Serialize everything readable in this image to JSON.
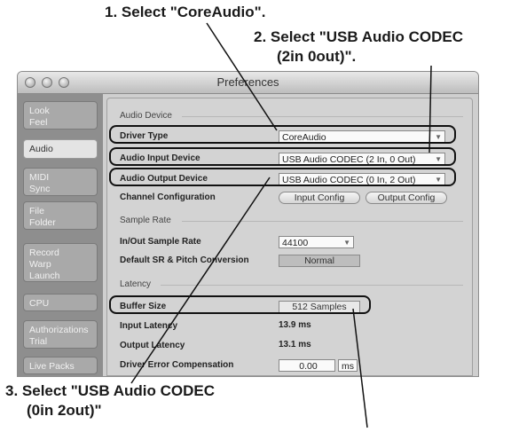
{
  "callouts": {
    "c1": "1. Select \"CoreAudio\".",
    "c2_line1": "2. Select \"USB Audio CODEC",
    "c2_line2": "(2in 0out)\".",
    "c3_line1": "3. Select \"USB Audio CODEC",
    "c3_line2": "(0in 2out)\""
  },
  "window": {
    "title": "Preferences"
  },
  "sidebar": {
    "tabs": [
      {
        "label": "Look\nFeel"
      },
      {
        "label": "Audio"
      },
      {
        "label": "MIDI\nSync"
      },
      {
        "label": "File\nFolder"
      },
      {
        "label": "Record\nWarp\nLaunch"
      },
      {
        "label": "CPU"
      },
      {
        "label": "Authorizations\nTrial"
      },
      {
        "label": "Live Packs"
      }
    ]
  },
  "audio_device": {
    "section": "Audio Device",
    "driver_type_label": "Driver Type",
    "driver_type_value": "CoreAudio",
    "input_device_label": "Audio Input Device",
    "input_device_value": "USB Audio CODEC  (2 In, 0 Out)",
    "output_device_label": "Audio Output Device",
    "output_device_value": "USB Audio CODEC  (0 In, 2 Out)",
    "channel_config_label": "Channel Configuration",
    "input_config_button": "Input Config",
    "output_config_button": "Output Config"
  },
  "sample_rate": {
    "section": "Sample Rate",
    "inout_label": "In/Out Sample Rate",
    "inout_value": "44100",
    "default_sr_label": "Default SR & Pitch Conversion",
    "default_sr_value": "Normal"
  },
  "latency": {
    "section": "Latency",
    "buffer_label": "Buffer Size",
    "buffer_value": "512 Samples",
    "input_latency_label": "Input Latency",
    "input_latency_value": "13.9 ms",
    "output_latency_label": "Output Latency",
    "output_latency_value": "13.1 ms",
    "driver_error_label": "Driver Error Compensation",
    "driver_error_value": "0.00",
    "driver_error_unit": "ms"
  }
}
